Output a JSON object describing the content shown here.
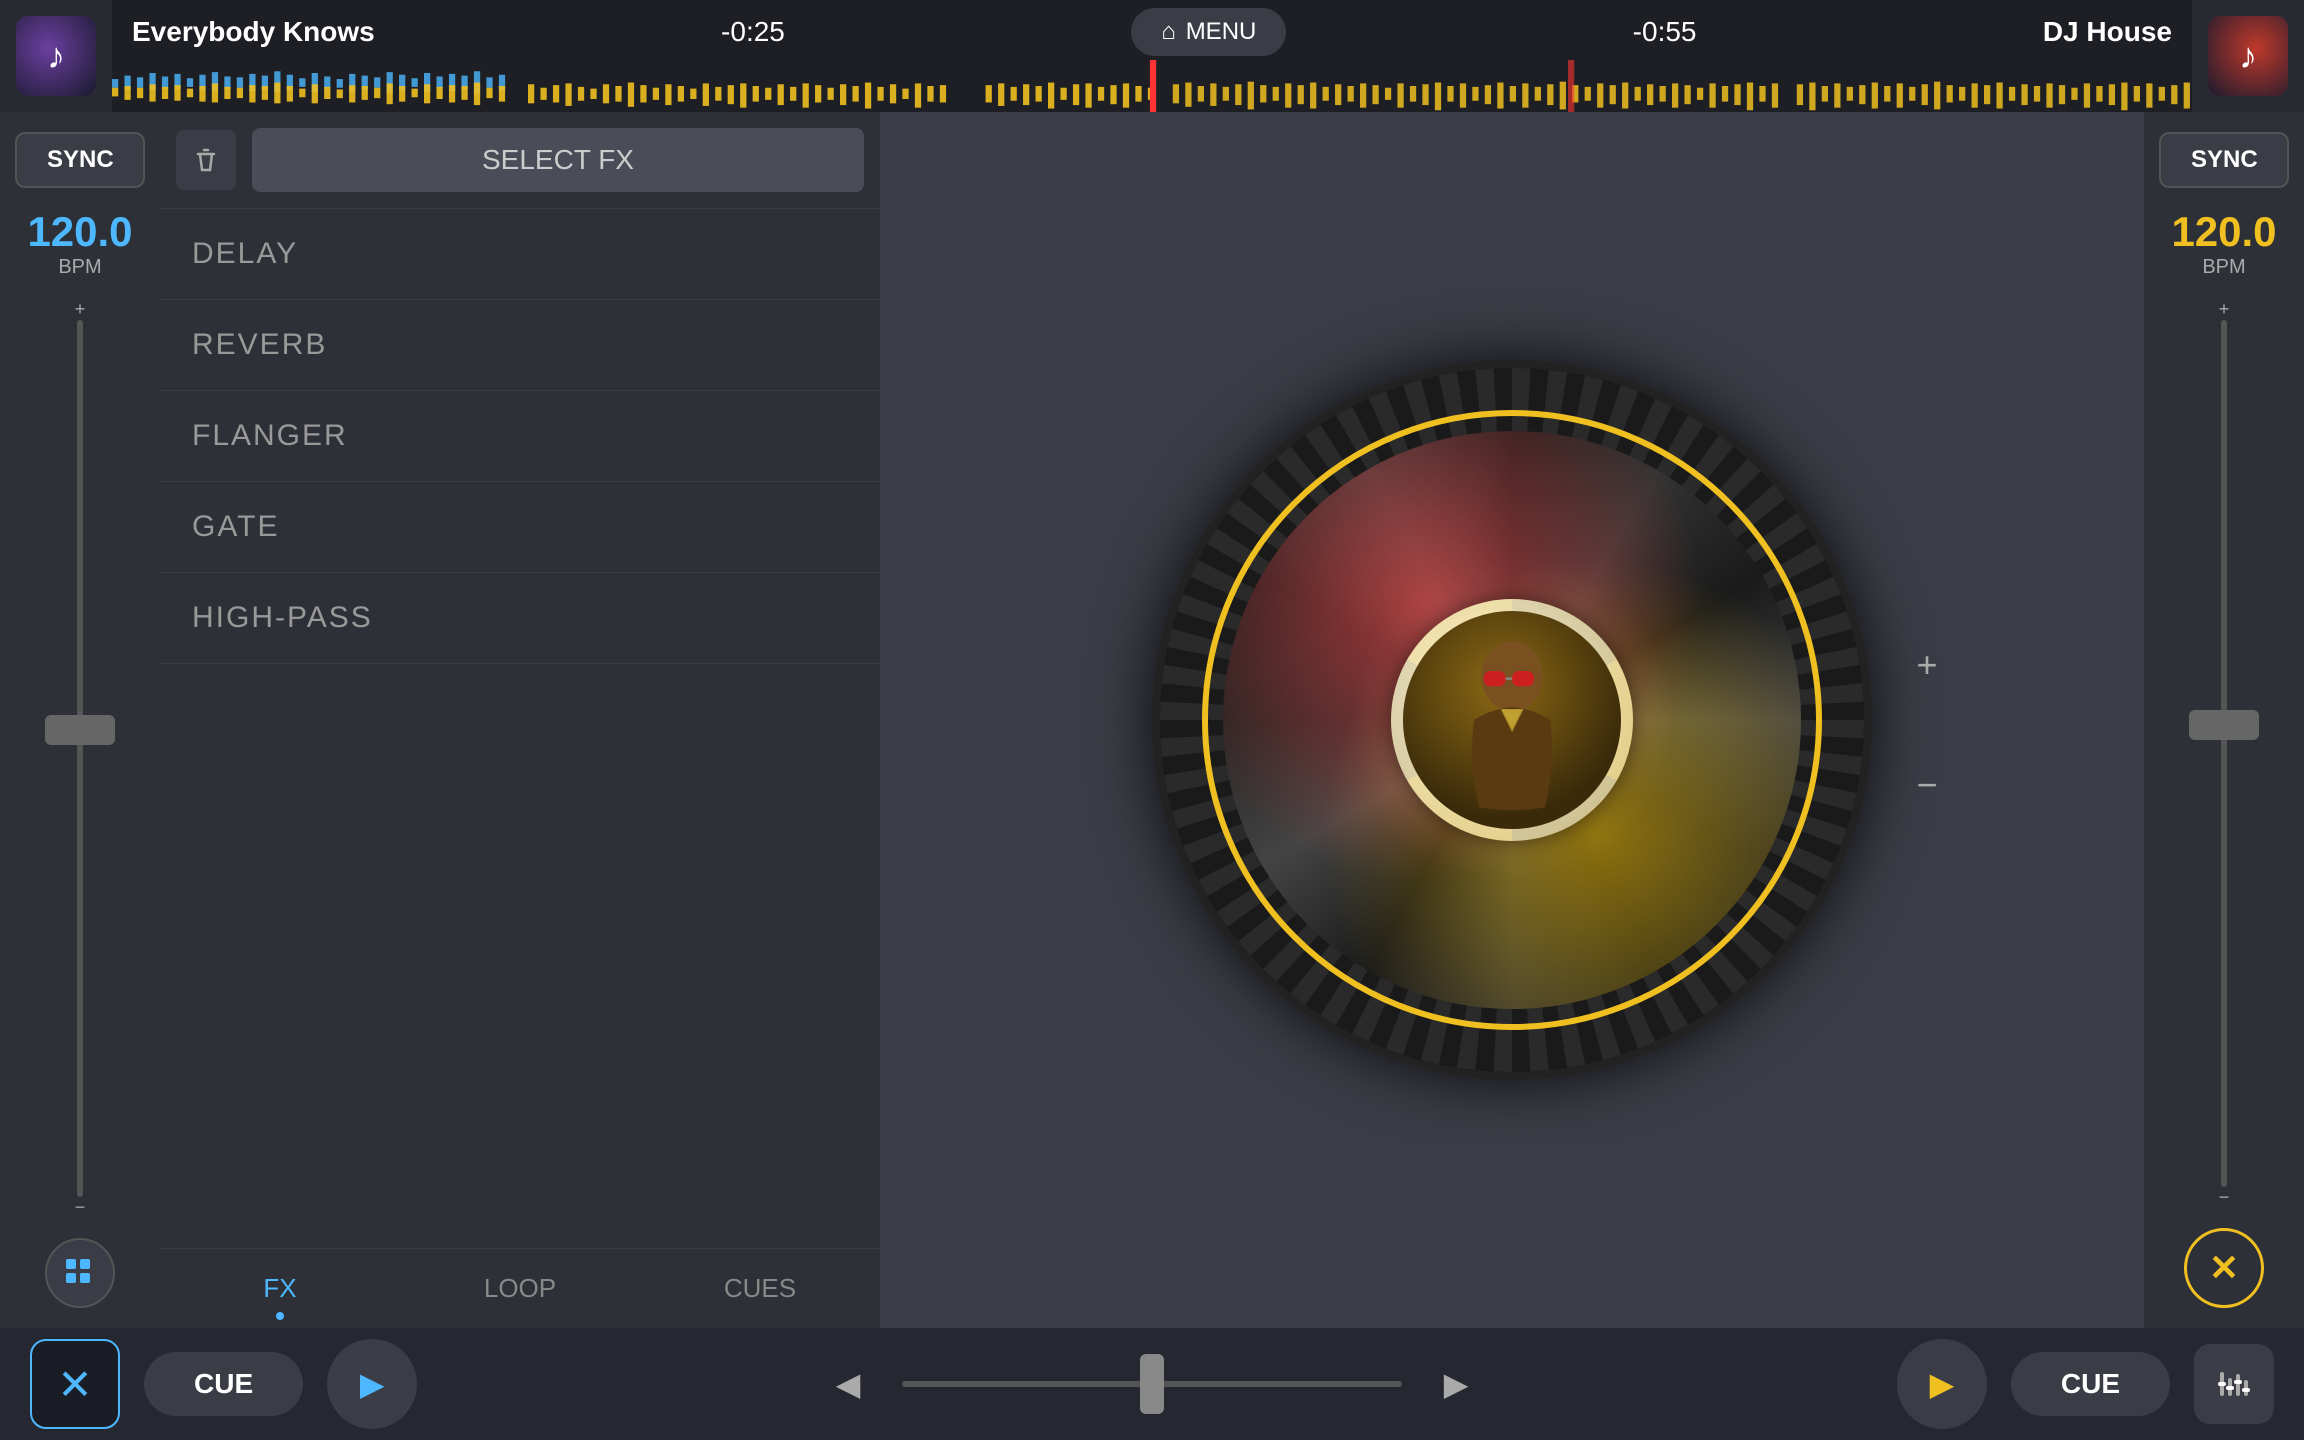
{
  "topBar": {
    "leftTrack": {
      "title": "Everybody Knows",
      "time": "-0:25"
    },
    "menuLabel": "MENU",
    "rightTrack": {
      "title": "DJ House",
      "time": "-0:55"
    }
  },
  "leftPanel": {
    "syncLabel": "SYNC",
    "bpm": "120.0",
    "bpmLabel": "BPM"
  },
  "rightPanel": {
    "syncLabel": "SYNC",
    "bpm": "120.0",
    "bpmLabel": "BPM"
  },
  "fxPanel": {
    "selectFxLabel": "SELECT FX",
    "items": [
      {
        "label": "DELAY"
      },
      {
        "label": "REVERB"
      },
      {
        "label": "FLANGER"
      },
      {
        "label": "GATE"
      },
      {
        "label": "HIGH-PASS"
      }
    ],
    "tabs": [
      {
        "label": "FX",
        "active": true
      },
      {
        "label": "LOOP",
        "active": false
      },
      {
        "label": "CUES",
        "active": false
      }
    ]
  },
  "bottomBar": {
    "closeBtnLabel": "✕",
    "leftCueLabel": "CUE",
    "leftPlayLabel": "▶",
    "prevLabel": "◀",
    "nextLabel": "▶",
    "rightPlayLabel": "▶",
    "rightCueLabel": "CUE",
    "equalizerLabel": "⊞"
  },
  "turntable": {
    "plusLabel": "+",
    "minusLabel": "−"
  }
}
